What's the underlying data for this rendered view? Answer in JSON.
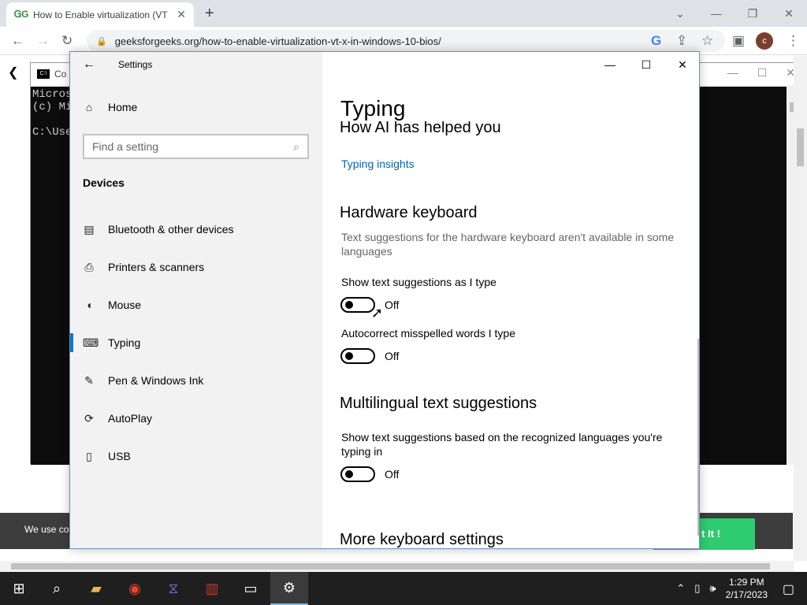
{
  "browser": {
    "tab_title": "How to Enable virtualization (VT",
    "tab_favicon": "geeksforgeeks-icon",
    "url": "geeksforgeeks.org/how-to-enable-virtualization-vt-x-in-windows-10-bios/",
    "avatar_letter": "c"
  },
  "cmd": {
    "title": "Co",
    "lines": "Micros\n(c) Mi\n\nC:\\Use"
  },
  "page": {
    "cookie_text": "We use co",
    "cookie_button": "t It !"
  },
  "settings": {
    "window_title": "Settings",
    "home_label": "Home",
    "search_placeholder": "Find a setting",
    "section": "Devices",
    "nav": [
      {
        "label": "Bluetooth & other devices",
        "icon": "bluetooth-devices-icon"
      },
      {
        "label": "Printers & scanners",
        "icon": "printer-icon"
      },
      {
        "label": "Mouse",
        "icon": "mouse-icon"
      },
      {
        "label": "Typing",
        "icon": "keyboard-icon",
        "active": true
      },
      {
        "label": "Pen & Windows Ink",
        "icon": "pen-icon"
      },
      {
        "label": "AutoPlay",
        "icon": "autoplay-icon"
      },
      {
        "label": "USB",
        "icon": "usb-icon"
      }
    ],
    "content": {
      "title": "Typing",
      "partial_heading": "How AI has helped you",
      "insights_link": "Typing insights",
      "hardware_heading": "Hardware keyboard",
      "hardware_desc": "Text suggestions for the hardware keyboard aren't available in some languages",
      "show_suggestions_label": "Show text suggestions as I type",
      "show_suggestions_state": "Off",
      "autocorrect_label": "Autocorrect misspelled words I type",
      "autocorrect_state": "Off",
      "multilingual_heading": "Multilingual text suggestions",
      "multilingual_label": "Show text suggestions based on the recognized languages you're typing in",
      "multilingual_state": "Off",
      "more_heading": "More keyboard settings"
    }
  },
  "taskbar": {
    "time": "1:29 PM",
    "date": "2/17/2023"
  }
}
